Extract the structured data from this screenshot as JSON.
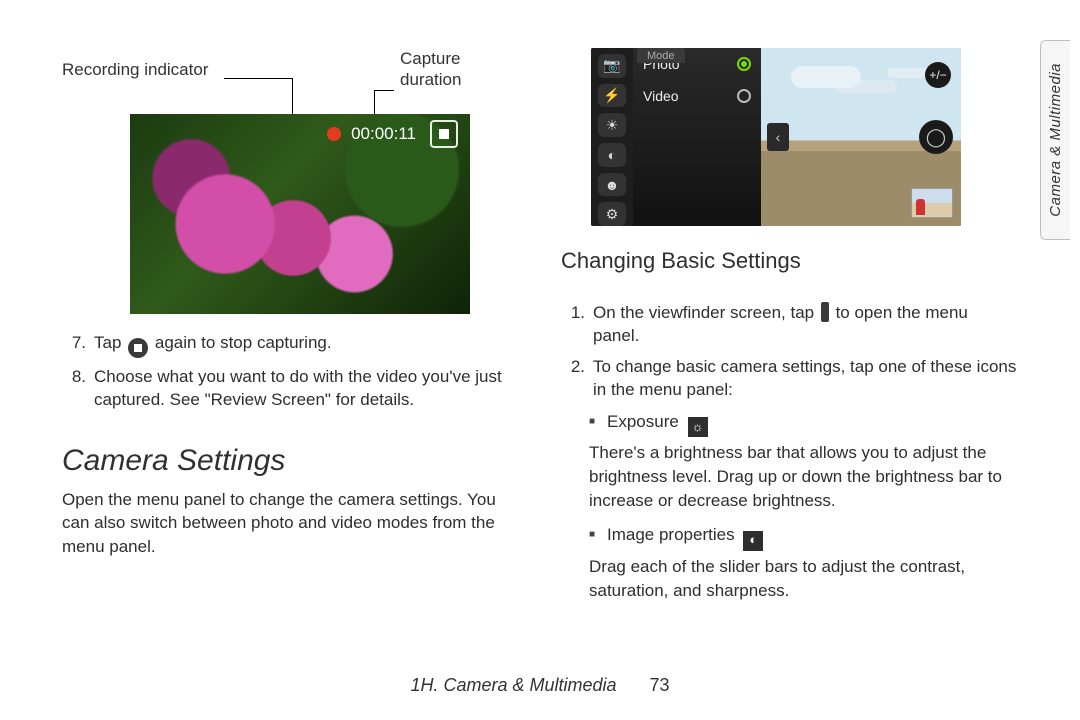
{
  "left": {
    "callout_rec": "Recording indicator",
    "callout_dur_l1": "Capture",
    "callout_dur_l2": "duration",
    "rec_time": "00:00:11",
    "list": {
      "n7": "7.",
      "t7a": "Tap ",
      "t7b": " again to stop capturing.",
      "n8": "8.",
      "t8": "Choose what you want to do with the video you've just captured. See \"Review Screen\" for details."
    },
    "h1": "Camera Settings",
    "p": "Open the menu panel to change the camera settings. You can also switch between photo and video modes from the menu panel."
  },
  "right": {
    "mode_tab": "Mode",
    "mode_photo": "Photo",
    "mode_video": "Video",
    "h2": "Changing Basic Settings",
    "s1n": "1.",
    "s1a": "On the viewfinder screen, tap ",
    "s1b": " to open the menu panel.",
    "s2n": "2.",
    "s2": "To change basic camera settings, tap one of these icons in the menu panel:",
    "b1": "Exposure",
    "b1p": "There's a brightness bar that allows you to adjust the brightness level. Drag up or down the brightness bar to increase or decrease brightness.",
    "b2": "Image properties",
    "b2p": "Drag each of the slider bars to adjust the contrast, saturation, and sharpness."
  },
  "footer": {
    "section": "1H. Camera & Multimedia",
    "page": "73"
  },
  "sidetab": "Camera & Multimedia",
  "icons": {
    "camera": "📷",
    "flash": "⚡",
    "bright": "☀",
    "contrast": "◐",
    "face": "☻",
    "more": "⚙",
    "pm": "+/−",
    "aperture": "◯",
    "chev": "‹",
    "exposure": "☼",
    "imgprop": "◐"
  }
}
